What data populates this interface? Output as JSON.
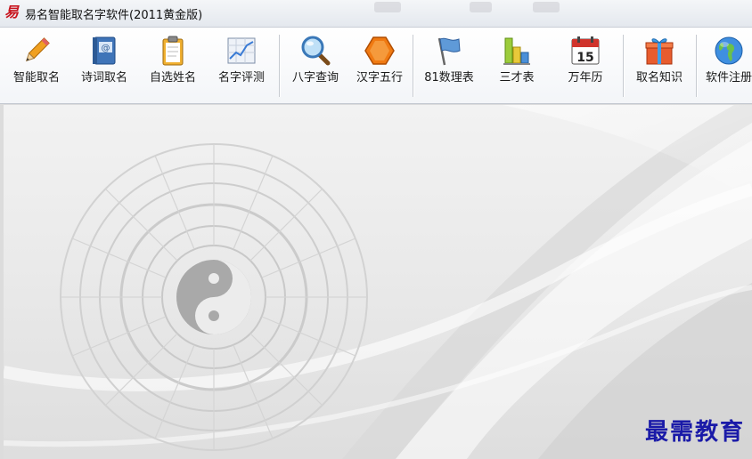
{
  "window": {
    "title": "易名智能取名字软件(2011黄金版)",
    "logo_text": "易"
  },
  "toolbar": {
    "buttons": [
      {
        "label": "智能取名",
        "icon": "pencil-icon"
      },
      {
        "label": "诗词取名",
        "icon": "address-book-icon"
      },
      {
        "label": "自选姓名",
        "icon": "clipboard-icon"
      },
      {
        "label": "名字评测",
        "icon": "line-chart-icon"
      },
      {
        "label": "八字查询",
        "icon": "magnifier-icon"
      },
      {
        "label": "汉字五行",
        "icon": "hexagon-icon"
      },
      {
        "label": "81数理表",
        "icon": "flag-icon"
      },
      {
        "label": "三才表",
        "icon": "bar-chart-icon"
      },
      {
        "label": "万年历",
        "icon": "calendar-icon"
      },
      {
        "label": "取名知识",
        "icon": "gift-icon"
      },
      {
        "label": "软件注册",
        "icon": "globe-icon"
      }
    ],
    "calendar_day": "15"
  },
  "watermark": "最需教育",
  "colors": {
    "accent_orange": "#f07a12",
    "watermark_blue": "#1a1aa8"
  }
}
